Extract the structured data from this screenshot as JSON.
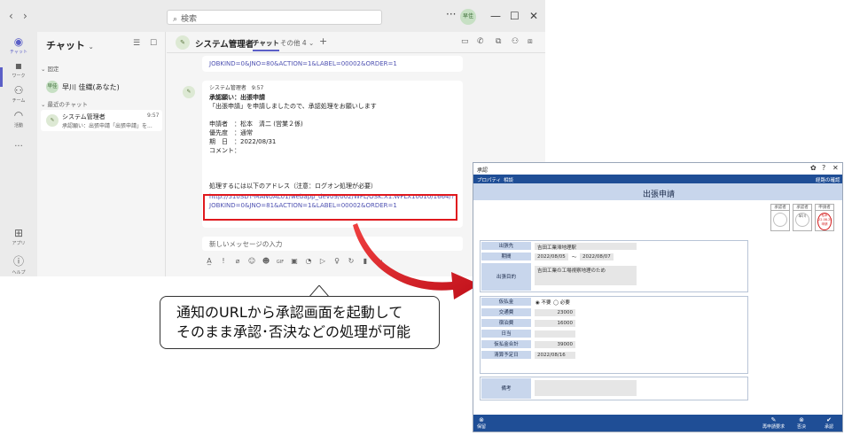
{
  "teams": {
    "search_placeholder": "検索",
    "nav_back": "‹",
    "nav_forward": "›",
    "user_initials": "早佳",
    "window_more": "···",
    "window_min": "—",
    "window_max": "☐",
    "window_close": "✕",
    "rail": [
      {
        "label": "チャット",
        "icon": "chat-icon"
      },
      {
        "label": "ワーク",
        "icon": "work-icon"
      },
      {
        "label": "チーム",
        "icon": "teams-icon"
      },
      {
        "label": "活動",
        "icon": "bell-icon"
      },
      {
        "label": "···",
        "icon": "more-icon"
      },
      {
        "label": "アプリ",
        "icon": "apps-icon"
      },
      {
        "label": "ヘルプ",
        "icon": "help-icon"
      }
    ],
    "chatlist": {
      "title": "チャット",
      "pinned_section": "固定",
      "pinned_user": "早川 佳織(あなた)",
      "pinned_initials": "早佳",
      "recent_section": "最近のチャット",
      "recent": {
        "name": "システム管理者",
        "time": "9:57",
        "preview": "承認願い：出張申請「出張申請」を..."
      }
    },
    "chat": {
      "name": "システム管理者",
      "tab_chat": "チャット",
      "tab_other": "その他 4 ⌄",
      "plus": "+",
      "top_message_tail": "JOBKIND=0&JNO=80&ACTION=1&LABEL=00002&ORDER=1",
      "message": {
        "sender": "システム管理者",
        "time": "9:57",
        "title": "承認願い：出張申請",
        "line1": "「出張申請」を申請しましたので、承認処理をお願いします",
        "applicant": "申請者　：松本　清二 (営業２係)",
        "priority": "優先度　：通常",
        "due": "期　日　：2022/08/31",
        "comment": "コメント：",
        "process_note": "処理するには以下のアドレス（注意：ログオン処理が必要）",
        "url_line1": " http://510SDT-MANUAL01/webapp_dev09/002/WFL/OSK.X1.WFLX10010/1664/?",
        "url_line2": "JOBKIND=0&JNO=81&ACTION=1&LABEL=00002&ORDER=1"
      },
      "composer_placeholder": "新しいメッセージの入力",
      "tools": [
        "A̲",
        "!",
        "⌀",
        "☺",
        "☻",
        "GIF",
        "▣",
        "◔",
        "▷",
        "♀",
        "↻",
        "▮",
        "···"
      ]
    }
  },
  "callout": {
    "line1": "通知のURLから承認画面を起動して",
    "line2": "そのまま承認･否決などの処理が可能"
  },
  "approval": {
    "window_title": "承認",
    "win_gear": "✿",
    "win_help": "?",
    "win_close": "✕",
    "menu_property": "プロパティ",
    "menu_related": "相談",
    "menu_history": "経路の確認",
    "heading": "出張申請",
    "stamps": [
      {
        "label": "承認者",
        "name": "",
        "red": false
      },
      {
        "label": "承認者",
        "name": "早川",
        "red": false
      },
      {
        "label": "申請者",
        "name": "松本 22.08.24 申請",
        "red": true
      }
    ],
    "fields": {
      "destination_label": "出張先",
      "destination": "吉田工業滞地理駅",
      "period_label": "期間",
      "period_from": "2022/08/05",
      "period_sep": "〜",
      "period_to": "2022/08/07",
      "purpose_label": "出張目的",
      "purpose": "吉田工業の工場視察地理のため",
      "advance_label": "仮払金",
      "advance_no": "◉ 不要",
      "advance_yes": "◯ 必要",
      "transport_label": "交通費",
      "transport": "23000",
      "lodging_label": "宿泊費",
      "lodging": "16000",
      "daily_label": "日当",
      "daily": "",
      "advance_total_label": "仮払金合計",
      "advance_total": "39000",
      "settle_label": "清算予定日",
      "settle": "2022/08/16",
      "note_label": "備考",
      "note": ""
    },
    "footer": {
      "hold": "保留",
      "reapply": "再申請要求",
      "reject": "否決",
      "approve": "承認"
    }
  },
  "colors": {
    "highlight": "#e0191e",
    "approval_blue": "#1f4e96",
    "label_bg": "#c8d6ec",
    "teams_purple": "#5b5fc7"
  }
}
